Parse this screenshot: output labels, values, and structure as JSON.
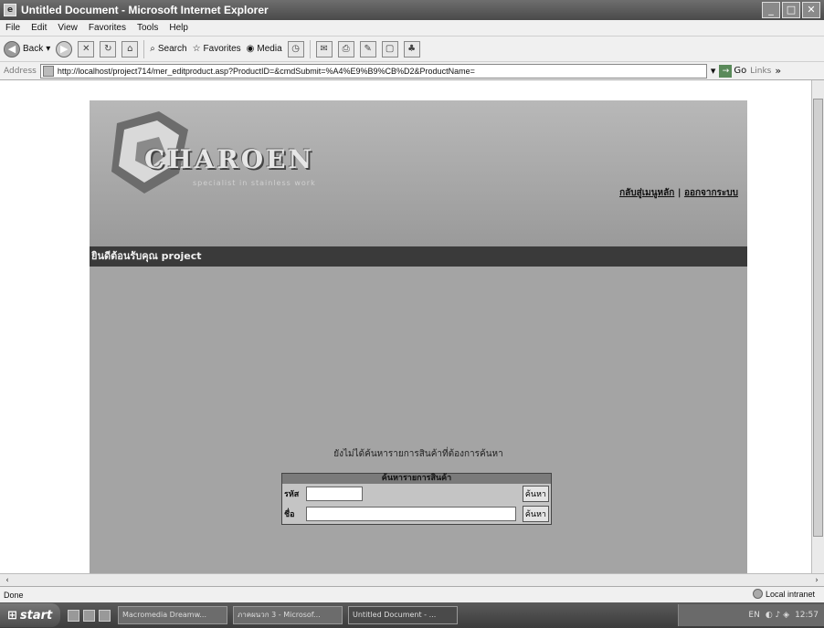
{
  "window": {
    "title": "Untitled Document - Microsoft Internet Explorer"
  },
  "menu": {
    "items": [
      "File",
      "Edit",
      "View",
      "Favorites",
      "Tools",
      "Help"
    ]
  },
  "toolbar": {
    "back": "Back",
    "search": "Search",
    "favorites": "Favorites",
    "media": "Media"
  },
  "address": {
    "label": "Address",
    "url": "http://localhost/project714/mer_editproduct.asp?ProductID=&cmdSubmit=%A4%E9%B9%CB%D2&ProductName=",
    "go": "Go",
    "links": "Links"
  },
  "page": {
    "logo_text": "CHAROEN",
    "logo_tagline": "specialist in stainless work",
    "links": [
      "กลับสู่เมนูหลัก",
      "ออกจากระบบ"
    ],
    "link_separator": "|",
    "section_title": "ยินดีต้อนรับคุณ project",
    "note": "ยังไม่ได้ค้นหารายการสินค้าที่ต้องการค้นหา",
    "search": {
      "header": "ค้นหารายการสินค้า",
      "code_label": "รหัส",
      "name_label": "ชื่อ",
      "button": "ค้นหา"
    }
  },
  "status": {
    "left": "Done",
    "zone": "Local intranet"
  },
  "taskbar": {
    "start": "start",
    "tasks": [
      "Macromedia Dreamw...",
      "ภาคผนวก 3 - Microsof...",
      "Untitled Document - ..."
    ],
    "lang": "EN",
    "clock": "12:57"
  }
}
